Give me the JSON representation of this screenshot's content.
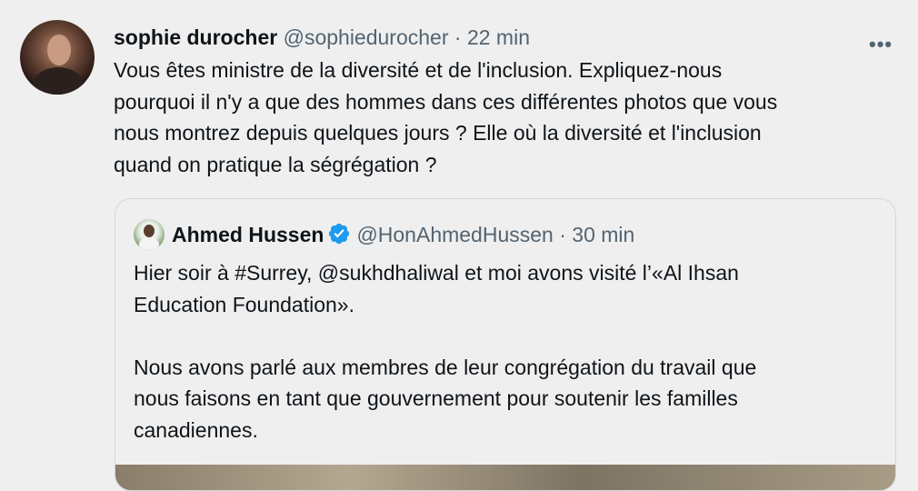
{
  "tweet": {
    "author_name": "sophie durocher",
    "author_handle": "@sophiedurocher",
    "separator": "·",
    "time": "22 min",
    "more_label": "•••",
    "lines": [
      "Vous êtes ministre de la diversité et de l'inclusion. Expliquez-nous",
      "pourquoi il n'y a que des hommes dans ces différentes photos que vous",
      "nous montrez depuis quelques jours ? Elle où la diversité et l'inclusion",
      "quand on pratique la ségrégation ?"
    ]
  },
  "quoted": {
    "author_name": "Ahmed Hussen",
    "verified_icon": "verified-badge-icon",
    "author_handle": "@HonAhmedHussen",
    "separator": "·",
    "time": "30 min",
    "lines": [
      "Hier soir à #Surrey, @sukhdhaliwal et moi avons visité l’«Al Ihsan",
      "Education Foundation».",
      "",
      "Nous avons parlé aux membres de leur congrégation du travail que",
      "nous faisons en tant que gouvernement pour soutenir les familles",
      "canadiennes."
    ]
  },
  "colors": {
    "background": "#efefef",
    "text": "#0f1419",
    "secondary": "#536471",
    "verified": "#1d9bf0",
    "border": "#cfd9de"
  }
}
